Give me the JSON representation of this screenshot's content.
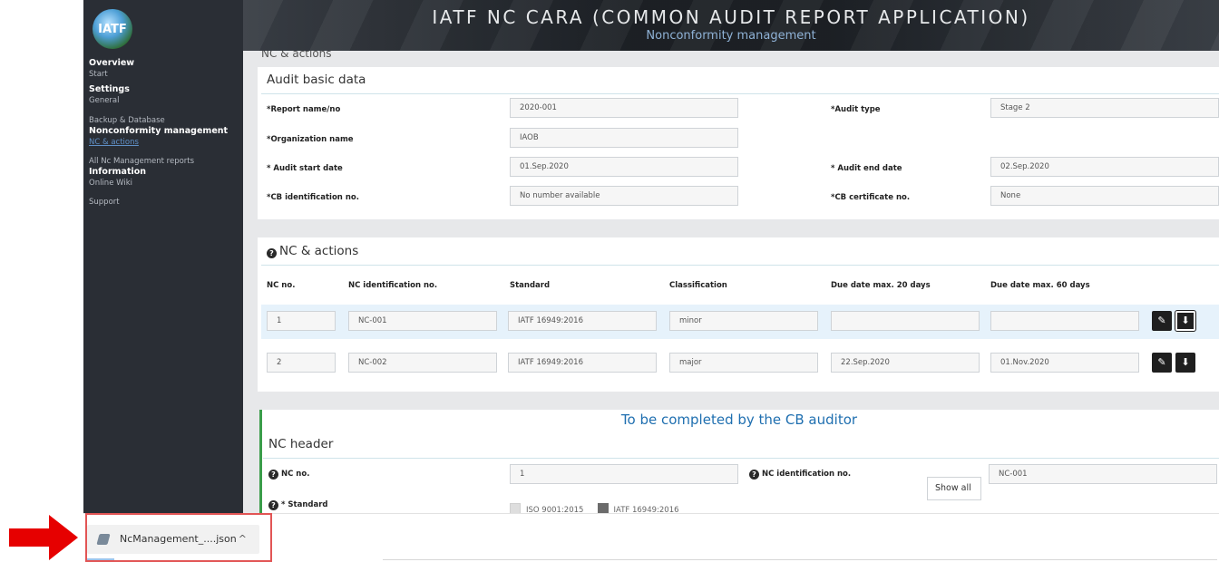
{
  "app": {
    "title": "IATF NC CARA (COMMON AUDIT REPORT APPLICATION)",
    "subtitle": "Nonconformity management",
    "logo_text": "IATF"
  },
  "sidebar": {
    "sections": [
      {
        "label": "Overview",
        "items": [
          {
            "label": "Start"
          }
        ]
      },
      {
        "label": "Settings",
        "items": [
          {
            "label": "General"
          },
          {
            "label": "Backup & Database"
          }
        ]
      },
      {
        "label": "Nonconformity management",
        "items": [
          {
            "label": "NC & actions",
            "active": true
          },
          {
            "label": "All Nc Management reports"
          }
        ]
      },
      {
        "label": "Information",
        "items": [
          {
            "label": "Online Wiki"
          },
          {
            "label": "Support"
          }
        ]
      }
    ]
  },
  "main": {
    "partial_title": "NC & actions",
    "audit_basic": {
      "title": "Audit basic data",
      "report_name_label": "*Report name/no",
      "report_name_value": "2020-001",
      "audit_type_label": "*Audit type",
      "audit_type_value": "Stage 2",
      "org_name_label": "*Organization name",
      "org_name_value": "IAOB",
      "start_date_label": "* Audit start date",
      "start_date_value": "01.Sep.2020",
      "end_date_label": "* Audit end date",
      "end_date_value": "02.Sep.2020",
      "cb_id_label": "*CB identification no.",
      "cb_id_value": "No number available",
      "cb_cert_label": "*CB certificate no.",
      "cb_cert_value": "None"
    },
    "nc_actions": {
      "title": "NC & actions",
      "columns": [
        "NC no.",
        "NC identification no.",
        "Standard",
        "Classification",
        "Due date max. 20 days",
        "Due date max. 60 days"
      ],
      "rows": [
        {
          "no": "1",
          "id": "NC-001",
          "standard": "IATF 16949:2016",
          "classification": "minor",
          "due20": "",
          "due60": ""
        },
        {
          "no": "2",
          "id": "NC-002",
          "standard": "IATF 16949:2016",
          "classification": "major",
          "due20": "22.Sep.2020",
          "due60": "01.Nov.2020"
        }
      ],
      "edit_icon": "pencil-icon",
      "download_icon": "download-icon"
    },
    "nc_header": {
      "banner": "To be completed by the CB auditor",
      "title": "NC header",
      "nc_no_label": "NC no.",
      "nc_no_value": "1",
      "nc_id_label": "NC identification no.",
      "nc_id_value": "NC-001",
      "standard_label": "* Standard",
      "standard_options": [
        {
          "label": "ISO 9001:2015",
          "checked": false
        },
        {
          "label": "IATF 16949:2016",
          "checked": true
        }
      ]
    },
    "show_all_label": "Show all"
  },
  "downloads": {
    "file_label": "NcManagement_....json",
    "chevron": "^"
  },
  "colors": {
    "sidebar_bg": "#2a2e35",
    "accent_blue": "#1f6fb0",
    "highlight_red": "#e25555",
    "green_bar": "#3a9d4a"
  }
}
